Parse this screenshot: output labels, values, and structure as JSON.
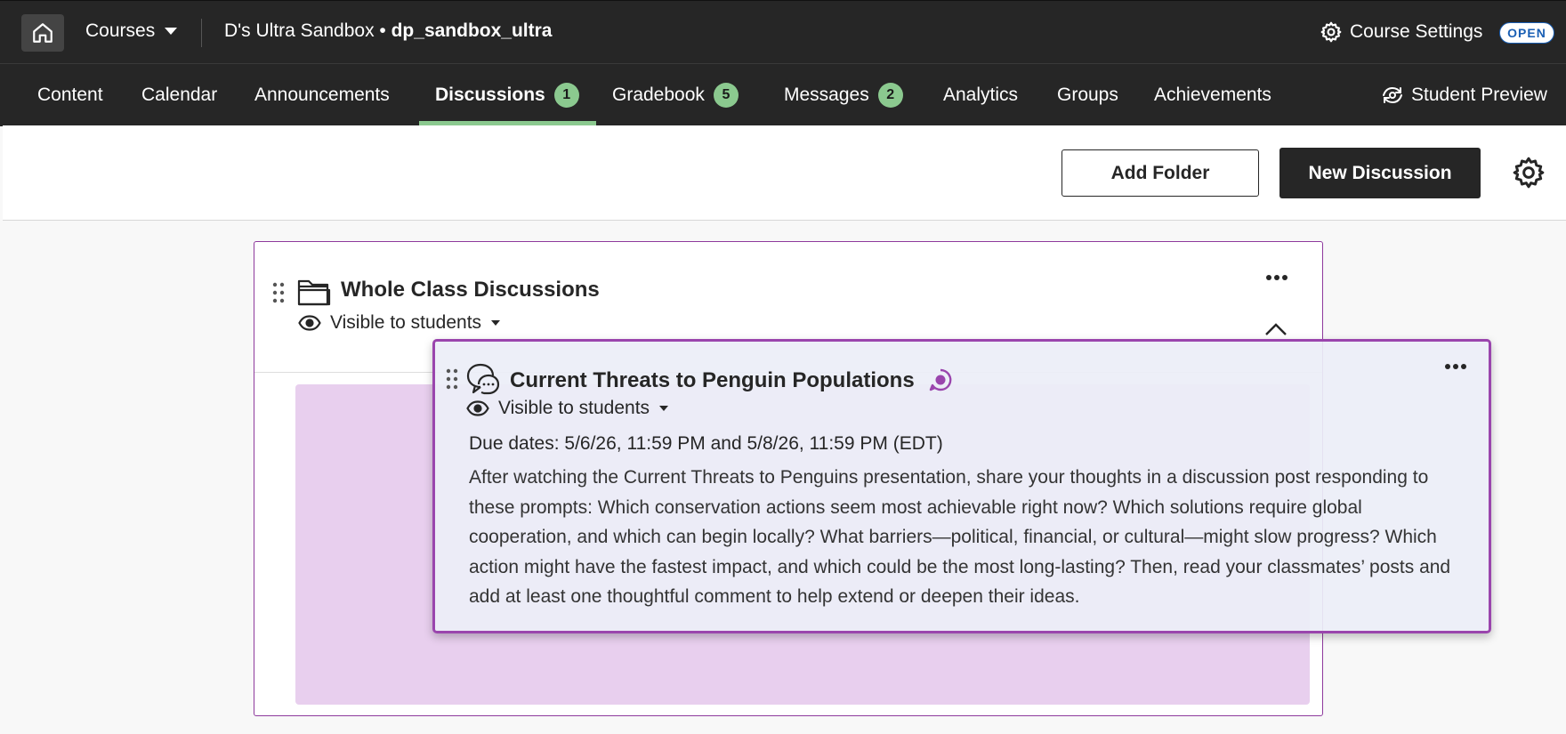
{
  "topbar": {
    "courses_label": "Courses",
    "course_prefix": "D's Ultra Sandbox • ",
    "course_id": "dp_sandbox_ultra",
    "settings_label": "Course Settings",
    "status_badge": "OPEN"
  },
  "nav": {
    "tabs": [
      {
        "label": "Content"
      },
      {
        "label": "Calendar"
      },
      {
        "label": "Announcements"
      },
      {
        "label": "Discussions",
        "count": "1",
        "active": true
      },
      {
        "label": "Gradebook",
        "count": "5"
      },
      {
        "label": "Messages",
        "count": "2"
      },
      {
        "label": "Analytics"
      },
      {
        "label": "Groups"
      },
      {
        "label": "Achievements"
      }
    ],
    "student_preview": "Student Preview"
  },
  "toolbar": {
    "add_folder": "Add Folder",
    "new_discussion": "New Discussion"
  },
  "folder": {
    "title": "Whole Class Discussions",
    "visibility": "Visible to students"
  },
  "discussion": {
    "title": "Current Threats to Penguin Populations",
    "visibility": "Visible to students",
    "due_dates": "Due dates: 5/6/26, 11:59 PM and 5/8/26, 11:59 PM (EDT)",
    "description": "After watching the Current Threats to Penguins presentation, share your thoughts in a discussion post responding to these prompts: Which conservation actions seem most achievable right now? Which solutions require global cooperation, and which can begin locally? What barriers—political, financial, or cultural—might slow progress? Which action might have the fastest impact, and which could be the most long-lasting? Then, read your classmates’ posts and add at least one thoughtful comment to help extend or deepen their ideas."
  },
  "colors": {
    "header_bg": "#262626",
    "active_tab_accent": "#8bc98f",
    "count_badge": "#8bc98f",
    "drag_border": "#9a45ad",
    "drop_zone": "#e8cfee",
    "open_badge": "#1a5fb4"
  },
  "icons": {
    "home": "home-icon",
    "courses_caret": "caret-down-icon",
    "settings": "gear-icon",
    "student_preview": "preview-icon",
    "folder": "folder-icon",
    "drag": "drag-handle-icon",
    "visibility": "eye-icon",
    "more": "more-options-icon",
    "collapse": "chevron-up-icon",
    "discussion": "discussion-icon",
    "participation": "participation-icon"
  }
}
